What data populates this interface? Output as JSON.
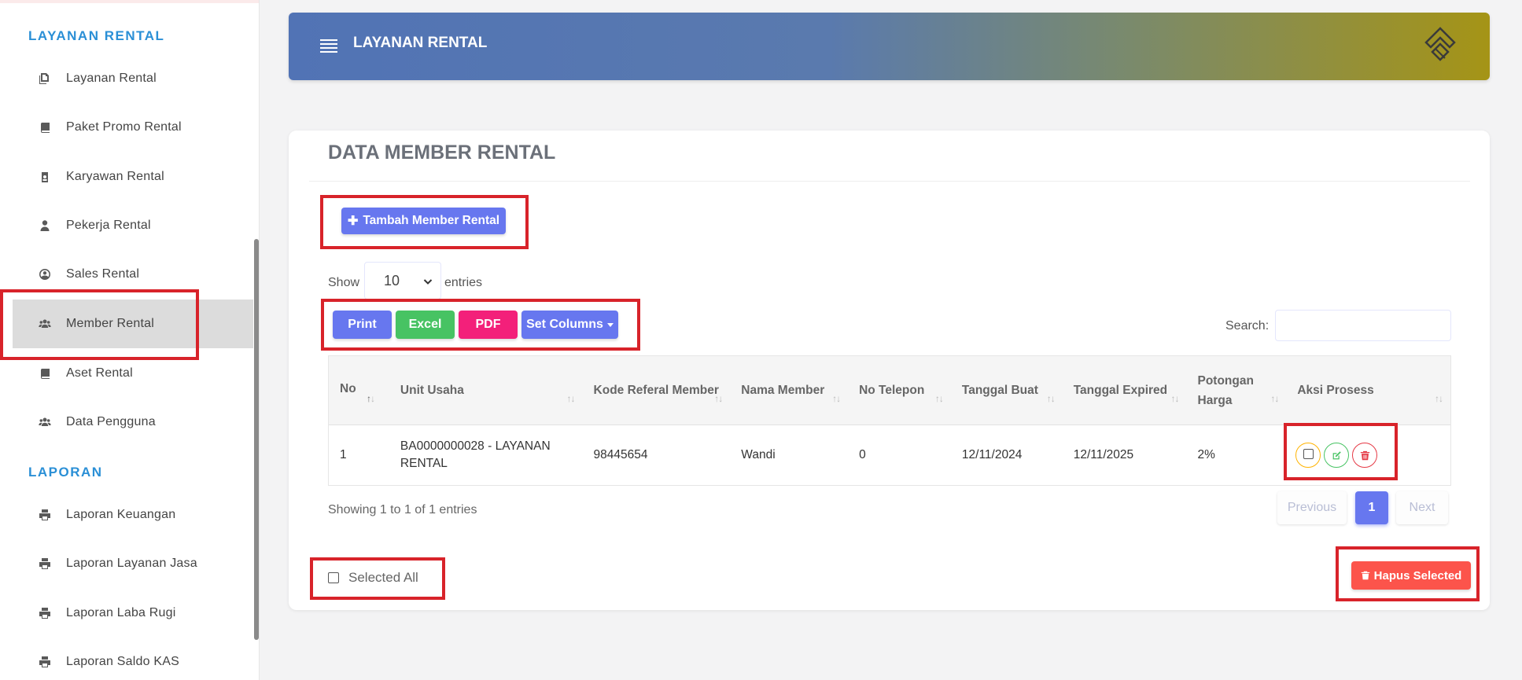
{
  "sidebar": {
    "section_rental": "LAYANAN RENTAL",
    "rental_items": [
      {
        "label": "Layanan Rental",
        "icon": "copy-icon"
      },
      {
        "label": "Paket Promo Rental",
        "icon": "book-icon"
      },
      {
        "label": "Karyawan Rental",
        "icon": "id-badge-icon"
      },
      {
        "label": "Pekerja Rental",
        "icon": "user-icon"
      },
      {
        "label": "Sales Rental",
        "icon": "user-circle-icon"
      },
      {
        "label": "Member Rental",
        "icon": "users-icon",
        "active": true
      },
      {
        "label": "Aset Rental",
        "icon": "book-icon"
      },
      {
        "label": "Data Pengguna",
        "icon": "users-icon"
      }
    ],
    "section_laporan": "LAPORAN",
    "laporan_items": [
      {
        "label": "Laporan Keuangan",
        "icon": "print-icon"
      },
      {
        "label": "Laporan Layanan Jasa",
        "icon": "print-icon"
      },
      {
        "label": "Laporan Laba Rugi",
        "icon": "print-icon"
      },
      {
        "label": "Laporan Saldo KAS",
        "icon": "print-icon"
      }
    ]
  },
  "header": {
    "title": "LAYANAN RENTAL",
    "gradient_start": "#5173b5",
    "gradient_end": "#a59416"
  },
  "card": {
    "title": "DATA MEMBER RENTAL",
    "add_button": "Tambah Member Rental",
    "show_label": "Show",
    "entries_value": "10",
    "entries_label": "entries",
    "export_buttons": {
      "print": "Print",
      "excel": "Excel",
      "pdf": "PDF",
      "columns": "Set Columns"
    },
    "search_label": "Search:",
    "search_value": ""
  },
  "table": {
    "headers": [
      "No",
      "Unit Usaha",
      "Kode Referal Member",
      "Nama Member",
      "No Telepon",
      "Tanggal Buat",
      "Tanggal Expired",
      "Potongan Harga",
      "Aksi Prosess"
    ],
    "rows": [
      [
        "1",
        "BA0000000028 - LAYANAN RENTAL",
        "98445654",
        "Wandi",
        "0",
        "12/11/2024",
        "12/11/2025",
        "2%"
      ]
    ]
  },
  "footer": {
    "showing": "Showing 1 to 1 of 1 entries",
    "previous": "Previous",
    "page": "1",
    "next": "Next",
    "select_all": "Selected All",
    "delete_selected": "Hapus Selected"
  },
  "colors": {
    "primary": "#6777ef",
    "success": "#47c363",
    "pink": "#f3207a",
    "danger": "#fc544b",
    "section_title": "#2a8fd6",
    "annotation": "#d8232a"
  }
}
